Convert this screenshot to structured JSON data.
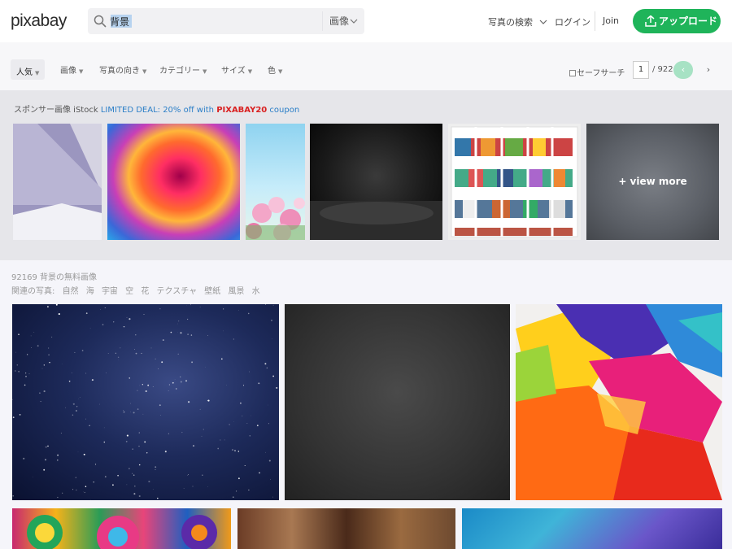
{
  "header": {
    "logo": "pixabay",
    "search_value": "背景",
    "search_type": "画像",
    "nav": {
      "explore": "写真の検索",
      "login": "ログイン",
      "join": "Join",
      "upload": "アップロード"
    }
  },
  "filters": {
    "popular": "人気",
    "images": "画像",
    "orientation": "写真の向き",
    "category": "カテゴリー",
    "size": "サイズ",
    "color": "色",
    "safesearch": "セーフサーチ",
    "page_current": "1",
    "page_total": "/ 922",
    "prev": "‹",
    "next": "›"
  },
  "sponsored": {
    "label": "スポンサー画像 iStock ",
    "deal": "LIMITED DEAL: 20% off with ",
    "code": "PIXABAY20",
    "coupon": " coupon",
    "view_more": "+ view more"
  },
  "results": {
    "count": "92169 背景の無料画像",
    "related_label": "関連の写真:",
    "related_tags": [
      "自然",
      "海",
      "宇宙",
      "空",
      "花",
      "テクスチャ",
      "壁紙",
      "風景",
      "水"
    ]
  },
  "colors": {
    "accent": "#1fb45a",
    "deal": "#2a7ec7",
    "code": "#d92020"
  }
}
